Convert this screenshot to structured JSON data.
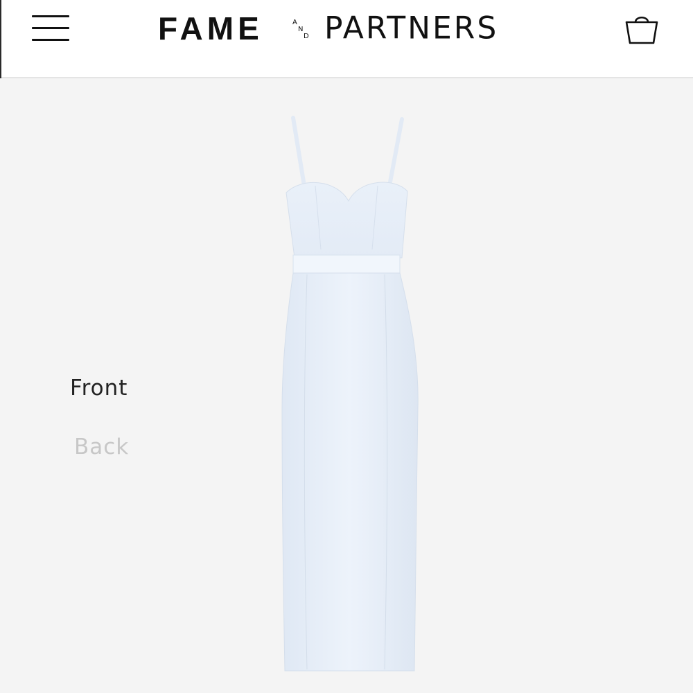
{
  "header": {
    "logo": {
      "word_left": "FAME",
      "word_and_top": "A",
      "word_and_mid": "N",
      "word_and_bottom": "D",
      "word_right": "PARTNERS"
    },
    "menu_icon": "hamburger-menu-icon",
    "cart_icon": "shopping-bag-icon"
  },
  "product_views": {
    "front_label": "Front",
    "back_label": "Back",
    "selected": "Front"
  },
  "product_image": {
    "description_icon": "dress-image",
    "dress_color": "#e8f0fa"
  },
  "colors": {
    "background": "#f4f4f4",
    "header_bg": "#ffffff",
    "active_text": "#222222",
    "inactive_text": "#c7c7c7"
  }
}
